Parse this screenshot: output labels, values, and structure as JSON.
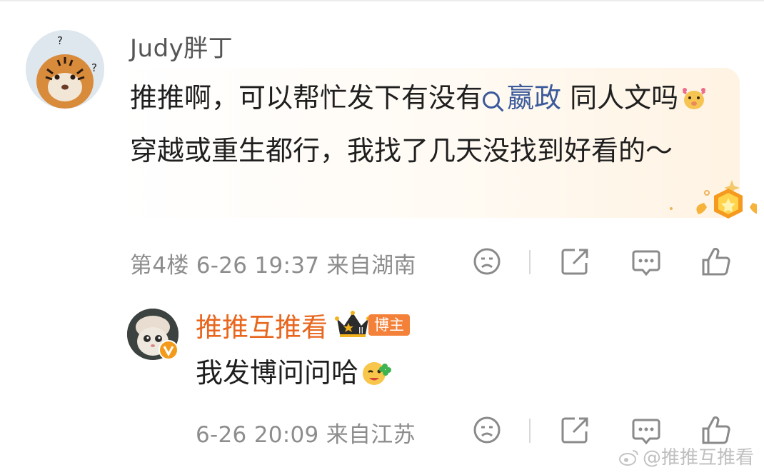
{
  "comment": {
    "username": "Judy胖丁",
    "text_part1": "推推啊，可以帮忙发下有没有",
    "topic": "嬴政",
    "text_part2": " 同人文吗",
    "text_part3": "穿越或重生都行，我找了几天没找到好看的～",
    "meta": "第4楼  6-26 19:37  来自湖南"
  },
  "reply": {
    "username": "推推互推看",
    "owner_badge": "博主",
    "text": "我发博问问哈",
    "meta": "6-26 20:09  来自江苏"
  },
  "icons": {
    "dislike": "sad-face-icon",
    "share": "share-icon",
    "comment": "comment-icon",
    "like": "thumbs-up-icon"
  },
  "watermark": "@推推互推看",
  "colors": {
    "username_reply": "#e8661e",
    "topic_link": "#3b5a9b",
    "owner_tag": "#f4813a",
    "meta_text": "#8d8d8d"
  }
}
